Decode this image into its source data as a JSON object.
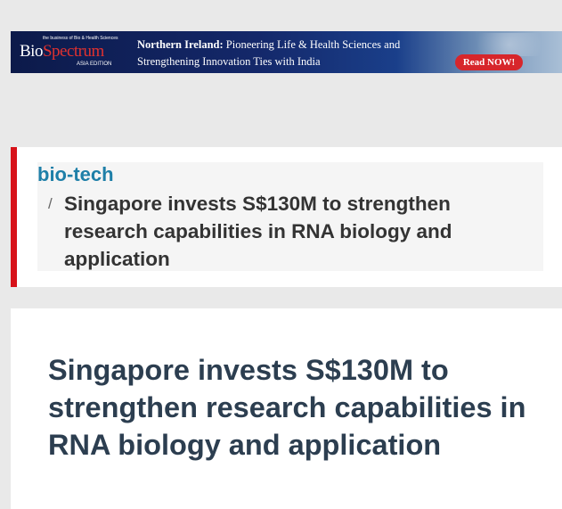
{
  "banner": {
    "logo": {
      "tagline": "the business of Bio & Health Sciences",
      "word_part1": "Bio",
      "word_part2": "Spectrum",
      "edition": "ASIA EDITION"
    },
    "headline_bold": "Northern Ireland:",
    "headline_rest": " Pioneering Life & Health Sciences and Strengthening Innovation Ties with India",
    "cta_label": "Read NOW!",
    "colors": {
      "cta": "#d7262b",
      "brand_red": "#e0312f",
      "background": "#0c1a4a"
    }
  },
  "breadcrumb": {
    "category": "bio-tech",
    "separator": "/",
    "current": "Singapore invests S$130M to strengthen research capabilities in RNA biology and application",
    "colors": {
      "accent_bar": "#d7121a",
      "link": "#1e7fa8"
    }
  },
  "article": {
    "title": "Singapore invests S$130M to strengthen research capabilities in RNA biology and application"
  }
}
